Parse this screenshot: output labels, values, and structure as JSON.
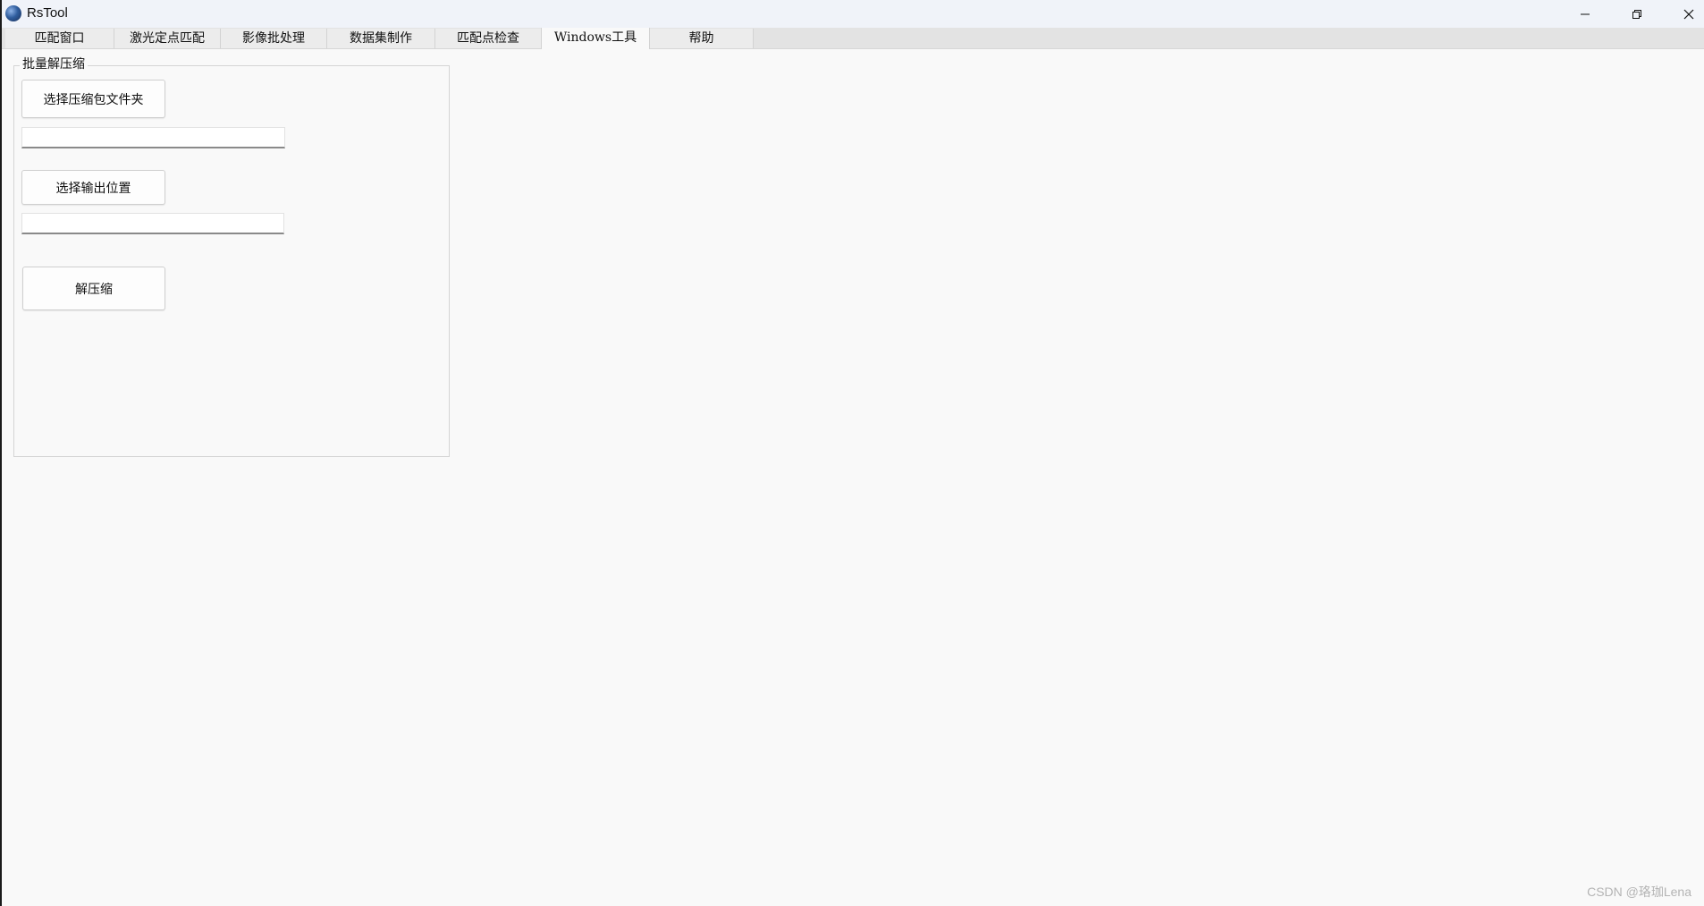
{
  "window": {
    "title": "RsTool",
    "icon": "globe-icon"
  },
  "tabs": [
    {
      "label": "匹配窗口"
    },
    {
      "label": "激光定点匹配"
    },
    {
      "label": "影像批处理"
    },
    {
      "label": "数据集制作"
    },
    {
      "label": "匹配点检查"
    },
    {
      "label": "Windows工具",
      "active": true
    },
    {
      "label": "帮助"
    }
  ],
  "batch_unzip": {
    "group_title": "批量解压缩",
    "select_archive_folder_label": "选择压缩包文件夹",
    "archive_folder_value": "",
    "select_output_label": "选择输出位置",
    "output_value": "",
    "unzip_label": "解压缩"
  },
  "watermark": "CSDN @珞珈Lena"
}
